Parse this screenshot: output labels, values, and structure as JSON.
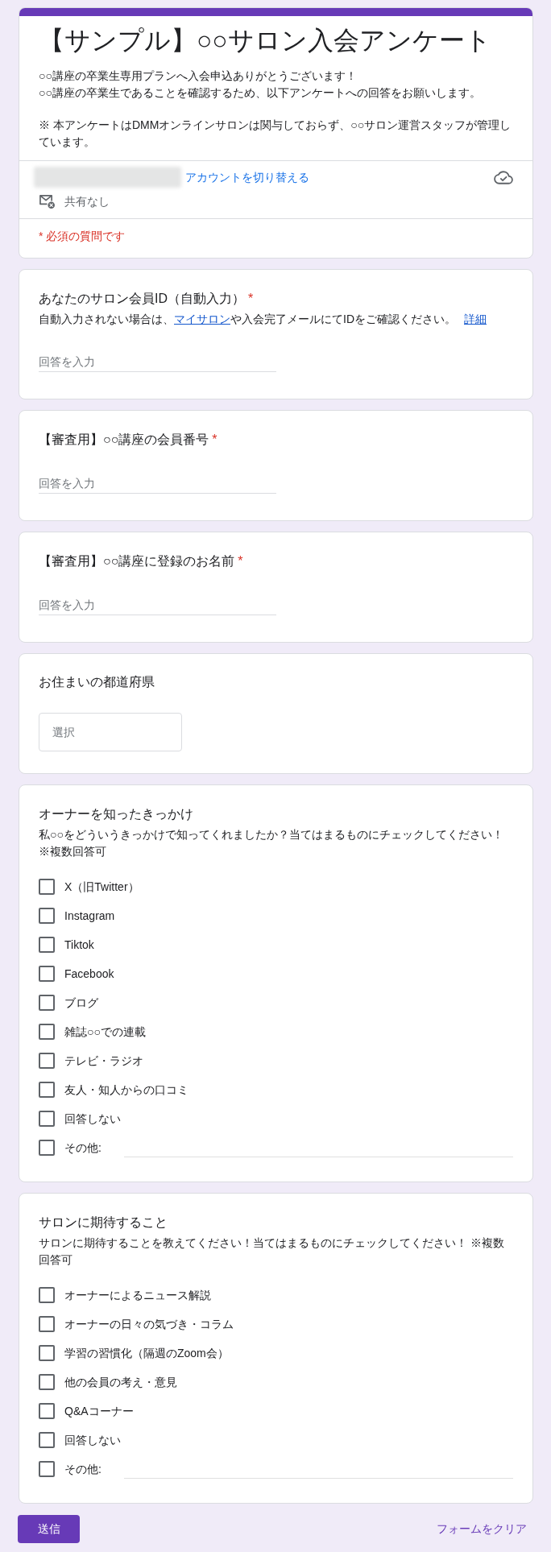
{
  "header": {
    "title": "【サンプル】○○サロン入会アンケート",
    "paragraphs": [
      {
        "lines": [
          "○○講座の卒業生専用プランへ入会申込ありがとうございます！",
          "○○講座の卒業生であることを確認するため、以下アンケートへの回答をお願いします。"
        ]
      },
      {
        "lines": [
          "※ 本アンケートはDMMオンラインサロンは関与しておらず、○○サロン運営スタッフが管理しています。"
        ]
      }
    ],
    "switch_account_link": "アカウントを切り替える",
    "sharing": "共有なし",
    "required_note": "* 必須の質問です"
  },
  "questions": [
    {
      "kind": "text",
      "title": "あなたのサロン会員ID（自動入力）",
      "required_mark": "*",
      "description_parts": [
        {
          "kind": "text",
          "text": "自動入力されない場合は、"
        },
        {
          "kind": "link",
          "text": "マイサロン"
        },
        {
          "kind": "text",
          "text": "や入会完了メールにてIDをご確認ください。"
        },
        {
          "kind": "link",
          "text": "詳細"
        }
      ],
      "placeholder": "回答を入力"
    },
    {
      "kind": "text",
      "title": "【審査用】○○講座の会員番号",
      "required_mark": "*",
      "placeholder": "回答を入力"
    },
    {
      "kind": "text",
      "title": "【審査用】○○講座に登録のお名前",
      "required_mark": "*",
      "placeholder": "回答を入力"
    },
    {
      "kind": "dropdown",
      "title": "お住まいの都道府県",
      "placeholder": "選択"
    },
    {
      "kind": "checkboxes",
      "title": "オーナーを知ったきっかけ",
      "description": "私○○をどういうきっかけで知ってくれましたか？当てはまるものにチェックしてください！ ※複数回答可",
      "options": [
        {
          "kind": "choice",
          "label": "X（旧Twitter）",
          "checked": false
        },
        {
          "kind": "choice",
          "label": "Instagram",
          "checked": false
        },
        {
          "kind": "choice",
          "label": "Tiktok",
          "checked": false
        },
        {
          "kind": "choice",
          "label": "Facebook",
          "checked": false
        },
        {
          "kind": "choice",
          "label": "ブログ",
          "checked": false
        },
        {
          "kind": "choice",
          "label": "雑誌○○での連載",
          "checked": false
        },
        {
          "kind": "choice",
          "label": "テレビ・ラジオ",
          "checked": false
        },
        {
          "kind": "choice",
          "label": "友人・知人からの口コミ",
          "checked": false
        },
        {
          "kind": "choice",
          "label": "回答しない",
          "checked": false
        },
        {
          "kind": "other",
          "label": "その他:",
          "checked": false
        }
      ]
    },
    {
      "kind": "checkboxes",
      "title": "サロンに期待すること",
      "description": "サロンに期待することを教えてください！当てはまるものにチェックしてください！ ※複数回答可",
      "options": [
        {
          "kind": "choice",
          "label": "オーナーによるニュース解説",
          "checked": false
        },
        {
          "kind": "choice",
          "label": "オーナーの日々の気づき・コラム",
          "checked": false
        },
        {
          "kind": "choice",
          "label": "学習の習慣化（隔週のZoom会）",
          "checked": false
        },
        {
          "kind": "choice",
          "label": "他の会員の考え・意見",
          "checked": false
        },
        {
          "kind": "choice",
          "label": "Q&Aコーナー",
          "checked": false
        },
        {
          "kind": "choice",
          "label": "回答しない",
          "checked": false
        },
        {
          "kind": "other",
          "label": "その他:",
          "checked": false
        }
      ]
    }
  ],
  "actions": {
    "submit": "送信",
    "clear": "フォームをクリア"
  }
}
